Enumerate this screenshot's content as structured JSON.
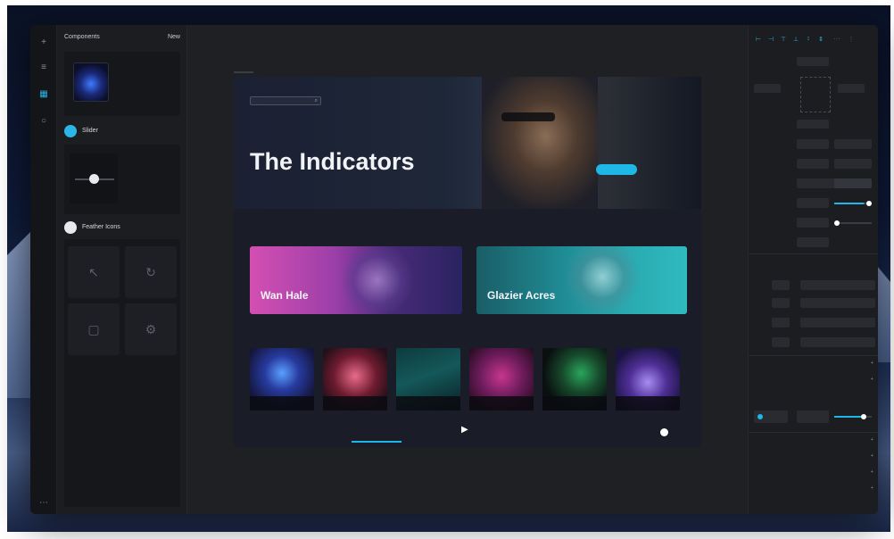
{
  "components_panel": {
    "title": "Components",
    "new_label": "New",
    "sections": [
      {
        "label": "Slider"
      },
      {
        "label": "Feather Icons"
      }
    ]
  },
  "canvas": {
    "hero": {
      "search_placeholder": "",
      "subtitle": "",
      "title": "The Indicators",
      "button_label": "",
      "link_label": ""
    },
    "recommended": {
      "label": "",
      "cards": [
        {
          "title": "Wan Hale",
          "meta": ""
        },
        {
          "title": "Glazier Acres",
          "meta": ""
        }
      ]
    },
    "new_releases": {
      "label": "",
      "albums": [
        {
          "name": "",
          "sub": ""
        },
        {
          "name": "",
          "sub": ""
        },
        {
          "name": "",
          "sub": ""
        },
        {
          "name": "",
          "sub": ""
        },
        {
          "name": "",
          "sub": ""
        },
        {
          "name": "",
          "sub": ""
        }
      ]
    }
  },
  "inspector": {
    "box": {
      "top": "",
      "left": "",
      "right": "",
      "bottom": ""
    },
    "props": [
      {
        "label": "",
        "value": "",
        "value2": ""
      },
      {
        "label": "",
        "value": "",
        "value2": ""
      },
      {
        "label": "",
        "seg": [
          "",
          ""
        ]
      },
      {
        "label": "",
        "value": ""
      },
      {
        "label": "",
        "value": ""
      },
      {
        "label": "",
        "value": ""
      }
    ],
    "object_section": "",
    "objects": [
      {
        "name": ""
      },
      {
        "name": ""
      },
      {
        "name": ""
      },
      {
        "name": ""
      }
    ],
    "sections_after": [
      "",
      "",
      ""
    ],
    "fill_value": "",
    "sections_bottom": [
      "",
      "",
      "",
      ""
    ]
  },
  "colors": {
    "accent": "#1fb8e6",
    "panel": "#1c1d21",
    "canvas": "#1f2024"
  }
}
